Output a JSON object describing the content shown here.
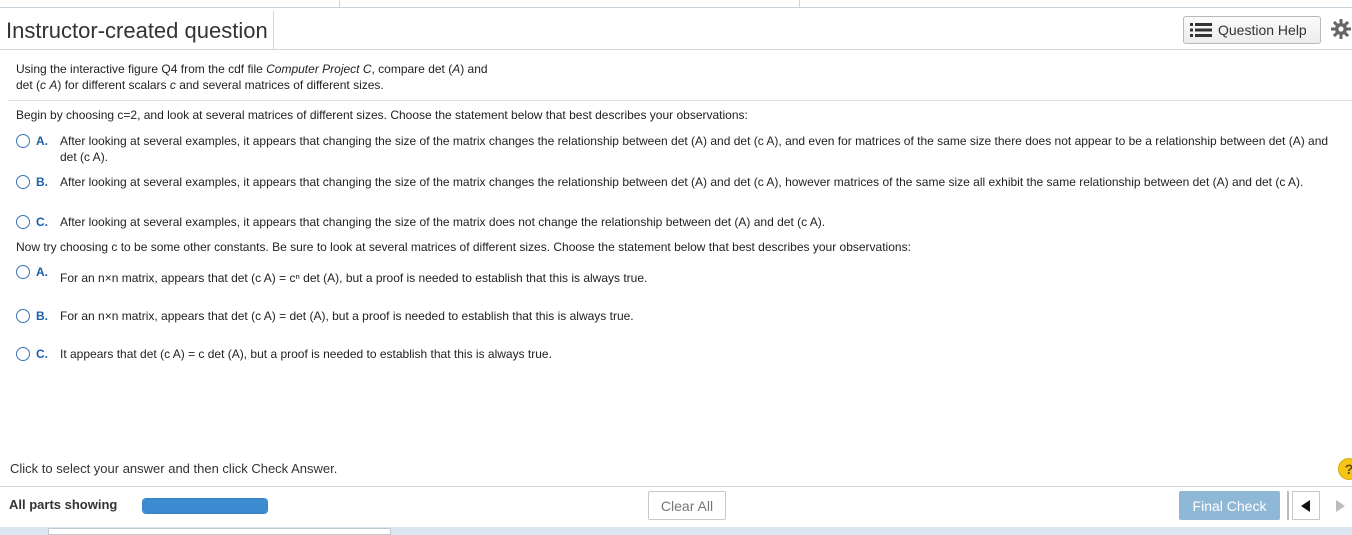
{
  "header": {
    "title": "Instructor-created question",
    "help_button_label": "Question Help"
  },
  "intro": {
    "part1": "Using the interactive figure Q4 from the cdf file ",
    "project": "Computer Project C",
    "part2": ", compare det (",
    "A1": "A",
    "part3": ") and",
    "line2_a": "det (",
    "c1": "c",
    "A2": "A",
    "line2_b": ") for different scalars ",
    "c2": "c",
    "line2_c": " and several matrices of different sizes."
  },
  "q1": {
    "prompt": "Begin by choosing c=2, and look at several matrices of different sizes.  Choose the statement below that best describes your observations:",
    "options": [
      {
        "letter": "A.",
        "text": "After looking at several examples, it appears that changing the size of the matrix changes the relationship between det (A) and det (c A),  and even for matrices of the same size there does not appear to be a relationship between det (A) and det (c A)."
      },
      {
        "letter": "B.",
        "text": "After looking at several examples, it appears that changing the size of the matrix changes the relationship between det (A) and det (c A), however matrices of the same size all exhibit the same relationship between det (A) and det (c A)."
      },
      {
        "letter": "C.",
        "text": "After looking at several examples, it appears that changing the size of the matrix does not change the relationship between det (A) and det (c A)."
      }
    ]
  },
  "q2": {
    "prompt": "Now try choosing c to be some other constants.  Be sure to look at several matrices of different sizes.  Choose the statement below that best describes your observations:",
    "options": [
      {
        "letter": "A.",
        "text": "For an n×n matrix, appears that det (c A) = cⁿ det (A), but a proof is needed to establish that this is always true."
      },
      {
        "letter": "B.",
        "text": "For an n×n matrix, appears that det (c A) = det (A), but a proof is needed to establish that this is always true."
      },
      {
        "letter": "C.",
        "text": "It appears that det (c A) = c det (A), but a proof is needed to establish that this is always true."
      }
    ]
  },
  "footer": {
    "instruction": "Click to select your answer and then click Check Answer.",
    "parts_label": "All parts showing",
    "progress_fraction": 1.0,
    "clear_label": "Clear All",
    "final_label": "Final Check"
  },
  "colors": {
    "accent": "#1a5fa8",
    "progress": "#3c8ad0",
    "final_button": "#8fb7d6",
    "help_icon": "#f5c518"
  },
  "icons": {
    "help": "list-icon",
    "settings": "gear-icon",
    "prev": "triangle-left-icon",
    "next": "triangle-right-icon",
    "hint": "question-mark-icon"
  }
}
